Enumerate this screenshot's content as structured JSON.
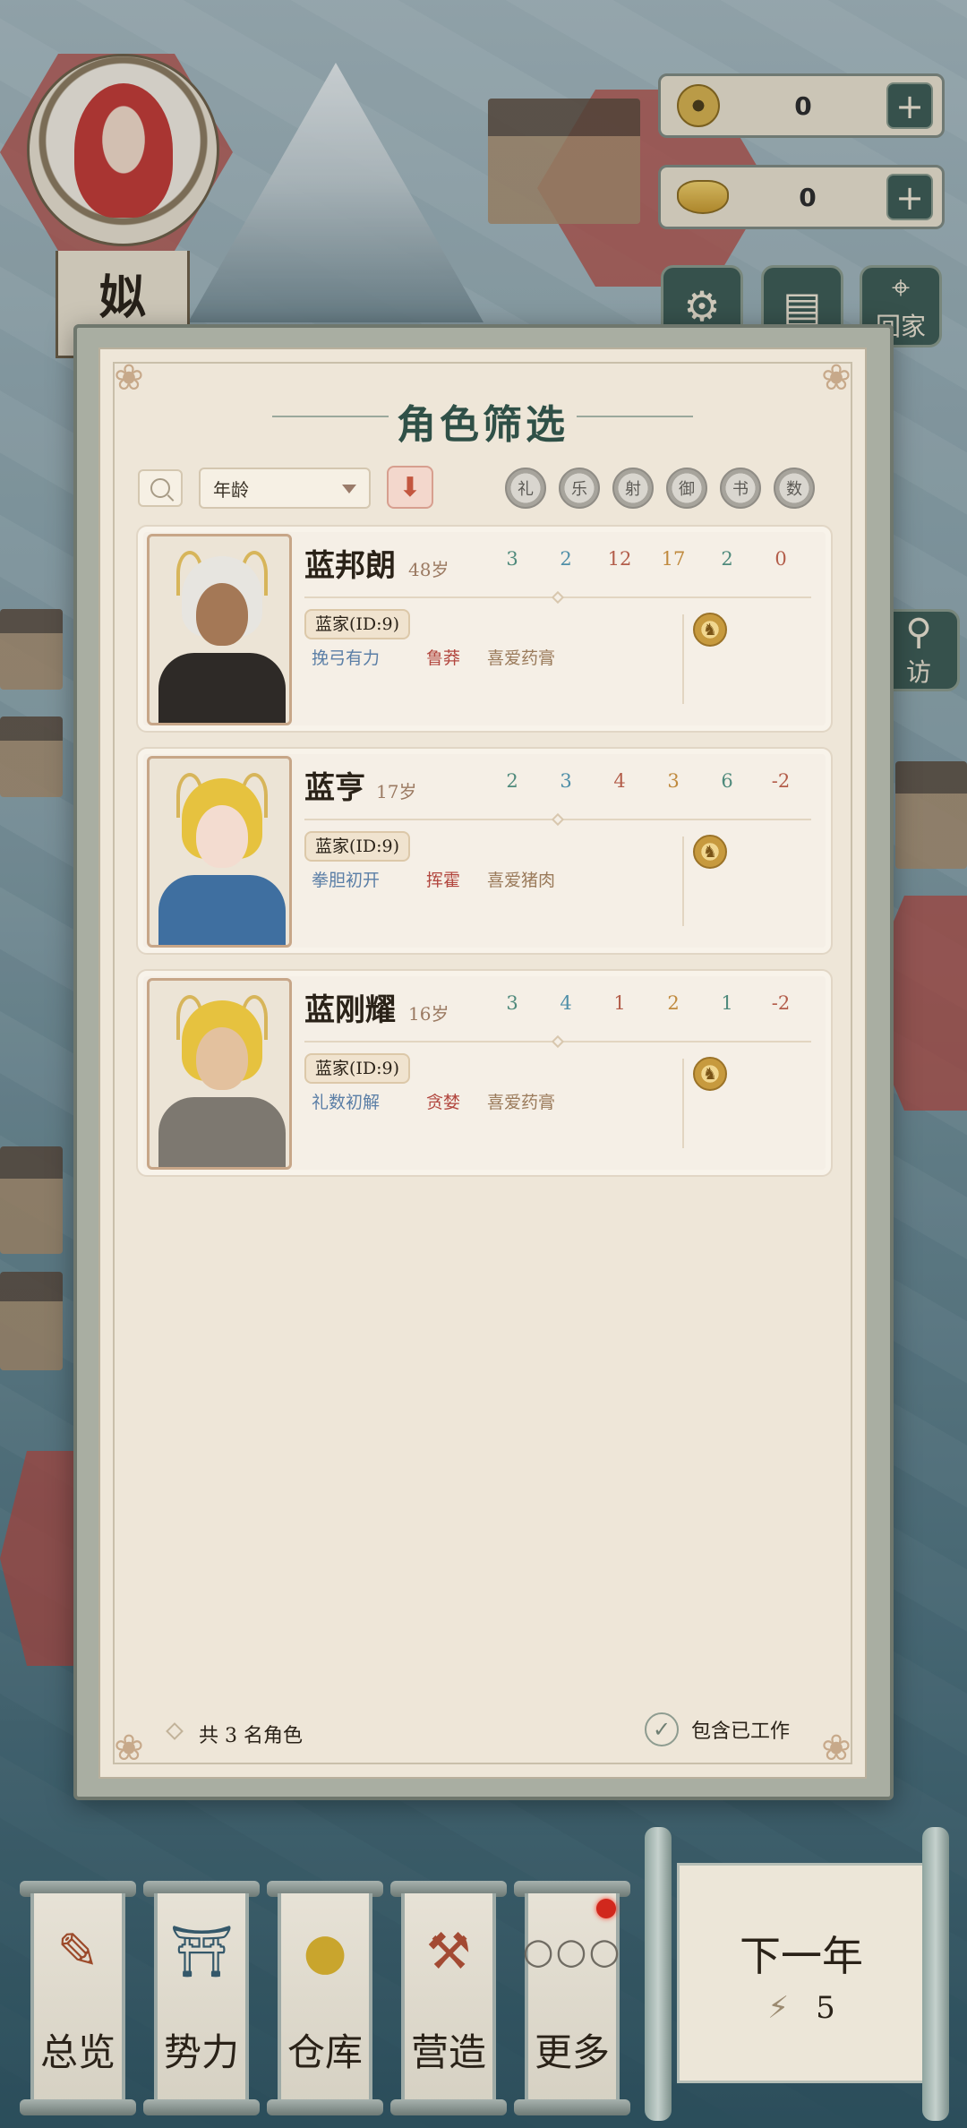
{
  "character": {
    "name": "姒"
  },
  "currencies": [
    {
      "icon": "coin-icon",
      "value": "0",
      "plus": "+"
    },
    {
      "icon": "gold-ingot-icon",
      "value": "0",
      "plus": "+"
    }
  ],
  "side_buttons": {
    "settings": "gear-icon",
    "save": "save-icon",
    "home_label": "回家",
    "visit_label": "访"
  },
  "panel": {
    "title": "角色筛选",
    "sort_field": "年龄",
    "sort_direction_glyph": "⬇",
    "attributes": [
      "礼",
      "乐",
      "射",
      "御",
      "书",
      "数"
    ],
    "count_text": "共 3 名角色",
    "include_worked_label": "包含已工作"
  },
  "roster": [
    {
      "name": "蓝邦朗",
      "age": "48岁",
      "stats": [
        "3",
        "2",
        "12",
        "17",
        "2",
        "0"
      ],
      "clan": "蓝家(ID:9)",
      "traits": [
        "挽弓有力",
        "鲁莽",
        "喜爱药膏"
      ],
      "hair_color": "#e7e5e0",
      "robe_color": "#2e2a27",
      "skin_color": "#a47856"
    },
    {
      "name": "蓝亨",
      "age": "17岁",
      "stats": [
        "2",
        "3",
        "4",
        "3",
        "6",
        "-2"
      ],
      "clan": "蓝家(ID:9)",
      "traits": [
        "拳胆初开",
        "挥霍",
        "喜爱猪肉"
      ],
      "hair_color": "#e6c23f",
      "robe_color": "#3f6fa0",
      "skin_color": "#f3dcd0"
    },
    {
      "name": "蓝刚耀",
      "age": "16岁",
      "stats": [
        "3",
        "4",
        "1",
        "2",
        "1",
        "-2"
      ],
      "clan": "蓝家(ID:9)",
      "traits": [
        "礼数初解",
        "贪婪",
        "喜爱药膏"
      ],
      "hair_color": "#e6c23f",
      "robe_color": "#7d7870",
      "skin_color": "#e3c19e"
    }
  ],
  "stat_colors": [
    "#4f8a7c",
    "#4f8fa8",
    "#b35d4a",
    "#c08a3e",
    "#4f8a7c",
    "#b35d4a"
  ],
  "trait_colors": [
    "#5a7ea6",
    "#b2473f",
    "#9a7a5a"
  ],
  "bottom_menu": [
    {
      "label": "总览",
      "icon": "brush-icon"
    },
    {
      "label": "势力",
      "icon": "temple-icon"
    },
    {
      "label": "仓库",
      "icon": "money-bag-icon"
    },
    {
      "label": "营造",
      "icon": "trowel-bricks-icon"
    },
    {
      "label": "更多",
      "icon": "more-icon"
    }
  ],
  "next_year": {
    "title": "下一年",
    "energy": "5"
  }
}
